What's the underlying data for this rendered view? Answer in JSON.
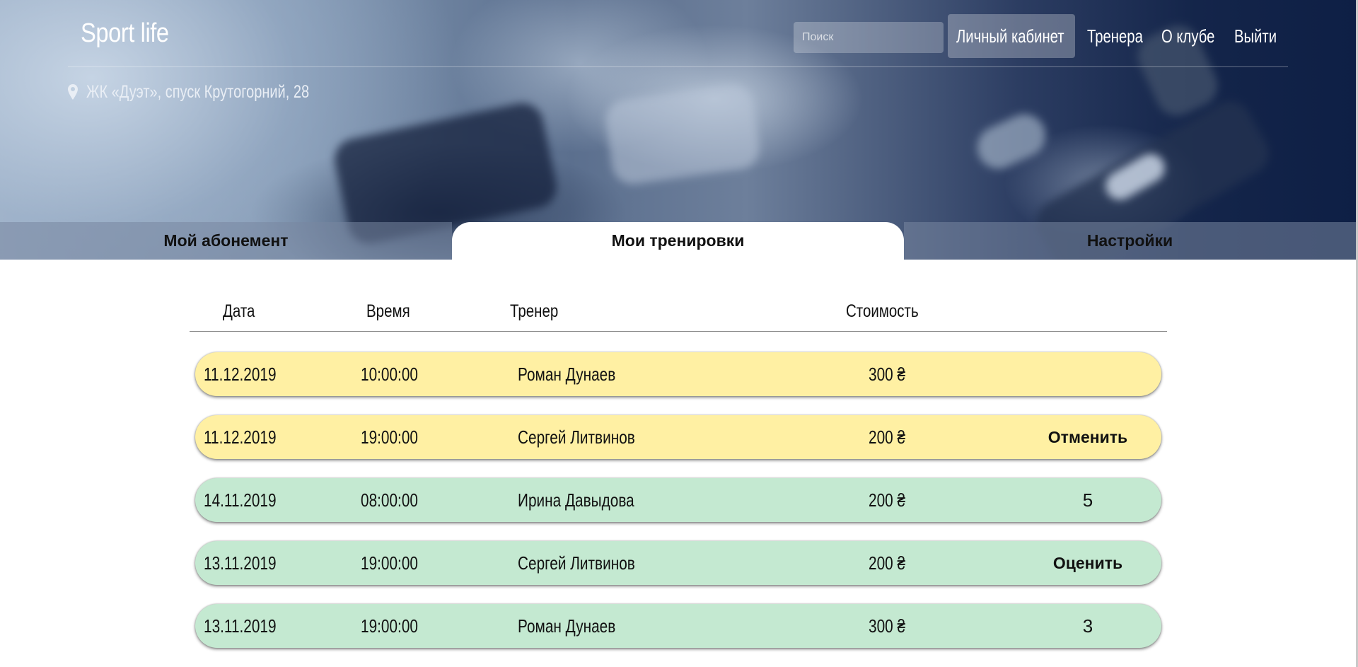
{
  "header": {
    "brand": "Sport life",
    "search_placeholder": "Поиск",
    "nav": [
      {
        "label": "Личный кабинет",
        "active": true
      },
      {
        "label": "Тренера",
        "active": false
      },
      {
        "label": "О клубе",
        "active": false
      },
      {
        "label": "Выйти",
        "active": false
      }
    ],
    "address": "ЖК «Дуэт», спуск Крутогорний, 28",
    "address_icon": "map-marker-icon"
  },
  "tabs": [
    {
      "label": "Мой абонемент",
      "active": false
    },
    {
      "label": "Мои тренировки",
      "active": true
    },
    {
      "label": "Настройки",
      "active": false
    }
  ],
  "table": {
    "columns": [
      "Дата",
      "Время",
      "Тренер",
      "Стоимость"
    ],
    "rows": [
      {
        "date": "11.12.2019",
        "time": "10:00:00",
        "trainer": "Роман Дунаев",
        "price": "300 ₴",
        "status": "upcoming",
        "action": "",
        "rating": ""
      },
      {
        "date": "11.12.2019",
        "time": "19:00:00",
        "trainer": "Сергей Литвинов",
        "price": "200 ₴",
        "status": "upcoming",
        "action": "Отменить",
        "rating": ""
      },
      {
        "date": "14.11.2019",
        "time": "08:00:00",
        "trainer": "Ирина Давыдова",
        "price": "200 ₴",
        "status": "past",
        "action": "",
        "rating": "5"
      },
      {
        "date": "13.11.2019",
        "time": "19:00:00",
        "trainer": "Сергей Литвинов",
        "price": "200 ₴",
        "status": "past",
        "action": "Оценить",
        "rating": ""
      },
      {
        "date": "13.11.2019",
        "time": "19:00:00",
        "trainer": "Роман Дунаев",
        "price": "300 ₴",
        "status": "past",
        "action": "",
        "rating": "3"
      }
    ]
  },
  "colors": {
    "upcoming_row": "#fff0a3",
    "past_row": "#c4e9d1",
    "header_dark": "#0e1f45"
  }
}
